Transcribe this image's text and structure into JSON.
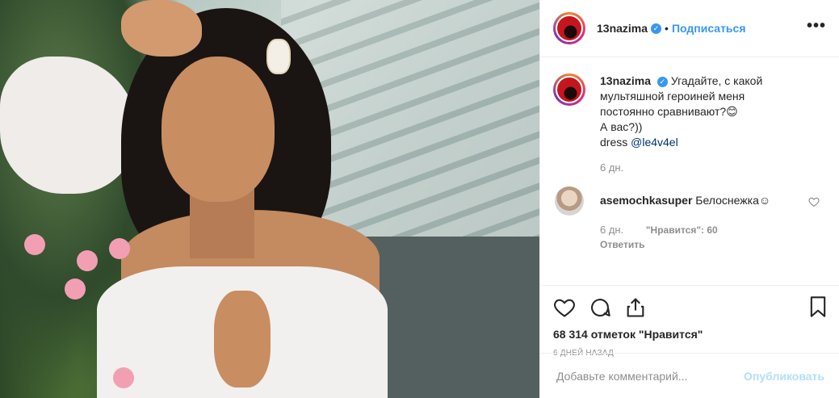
{
  "post": {
    "image_alt": "Woman in white off-shoulder dress with flowers",
    "author": {
      "username": "13nazima",
      "verified": true,
      "separator": "•",
      "follow_label": "Подписаться",
      "more_label": "•••"
    },
    "caption": {
      "username": "13nazima",
      "line1": "Угадайте, с какой",
      "line2": "мультяшной героиней меня",
      "line3": "постоянно сравнивают?😊",
      "line4": "А вас?))",
      "line5_prefix": "dress ",
      "mention": "@le4v4el",
      "time": "6 дн."
    },
    "comments": [
      {
        "username": "asemochkasuper",
        "text": "Белоснежка☺",
        "time": "6 дн.",
        "likes": "\"Нравится\": 60",
        "reply_label": "Ответить"
      }
    ],
    "actions": {
      "like_icon": "heart-icon",
      "comment_icon": "comment-icon",
      "share_icon": "share-icon",
      "save_icon": "bookmark-icon"
    },
    "likes_text": "68 314 отметок \"Нравится\"",
    "time_ago": "6 ДНЕЙ НАЗАД",
    "add_comment": {
      "placeholder": "Добавьте комментарий...",
      "publish_label": "Опубликовать"
    }
  },
  "colors": {
    "accent": "#3897f0",
    "publish_disabled": "#b2dffc",
    "muted": "#8e8e8e",
    "text": "#262626"
  }
}
